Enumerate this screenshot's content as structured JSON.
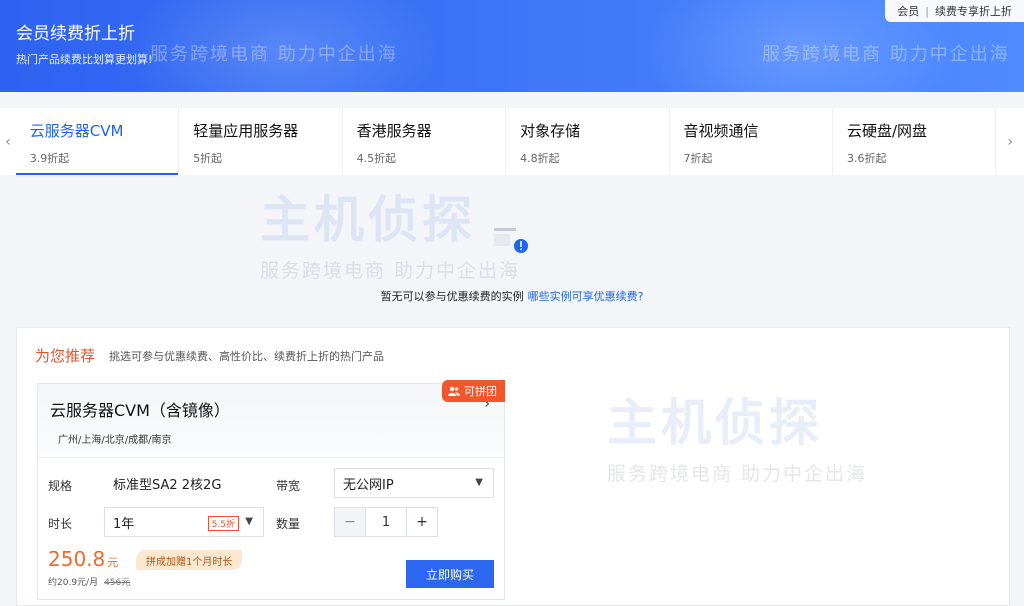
{
  "banner": {
    "title": "会员续费折上折",
    "subtitle": "热门产品续费比划算更划算!",
    "link_member": "会员",
    "link_exclusive": "续费专享折上折"
  },
  "watermark": {
    "logo": "主机侦探",
    "slogan": "服务跨境电商 助力中企出海"
  },
  "tabs": [
    {
      "name": "云服务器CVM",
      "price": "3.9折起",
      "active": true
    },
    {
      "name": "轻量应用服务器",
      "price": "5折起"
    },
    {
      "name": "香港服务器",
      "price": "4.5折起"
    },
    {
      "name": "对象存储",
      "price": "4.8折起"
    },
    {
      "name": "音视频通信",
      "price": "7折起"
    },
    {
      "name": "云硬盘/网盘",
      "price": "3.6折起"
    }
  ],
  "empty": {
    "text": "暂无可以参与优惠续费的实例",
    "link": "哪些实例可享优惠续费?"
  },
  "recommend": {
    "title": "为您推荐",
    "desc": "挑选可参与优惠续费、高性价比、续费折上折的热门产品",
    "card": {
      "title": "云服务器CVM（含镜像）",
      "regions": "广州/上海/北京/成都/南京",
      "badge": "可拼团",
      "spec_label": "规格",
      "spec_value": "标准型SA2 2核2G",
      "bandwidth_label": "带宽",
      "bandwidth_value": "无公网IP",
      "duration_label": "时长",
      "duration_value": "1年",
      "duration_discount": "5.5折",
      "qty_label": "数量",
      "qty_value": "1",
      "price": "250.8",
      "price_unit": "元",
      "promo": "拼成加赠1个月时长",
      "monthly": "约20.9元/月",
      "original": "456元",
      "buy_label": "立即购买"
    }
  },
  "colors": {
    "accent": "#1f64f0",
    "orange": "#f06a2c",
    "banner": "#3b74f7"
  }
}
